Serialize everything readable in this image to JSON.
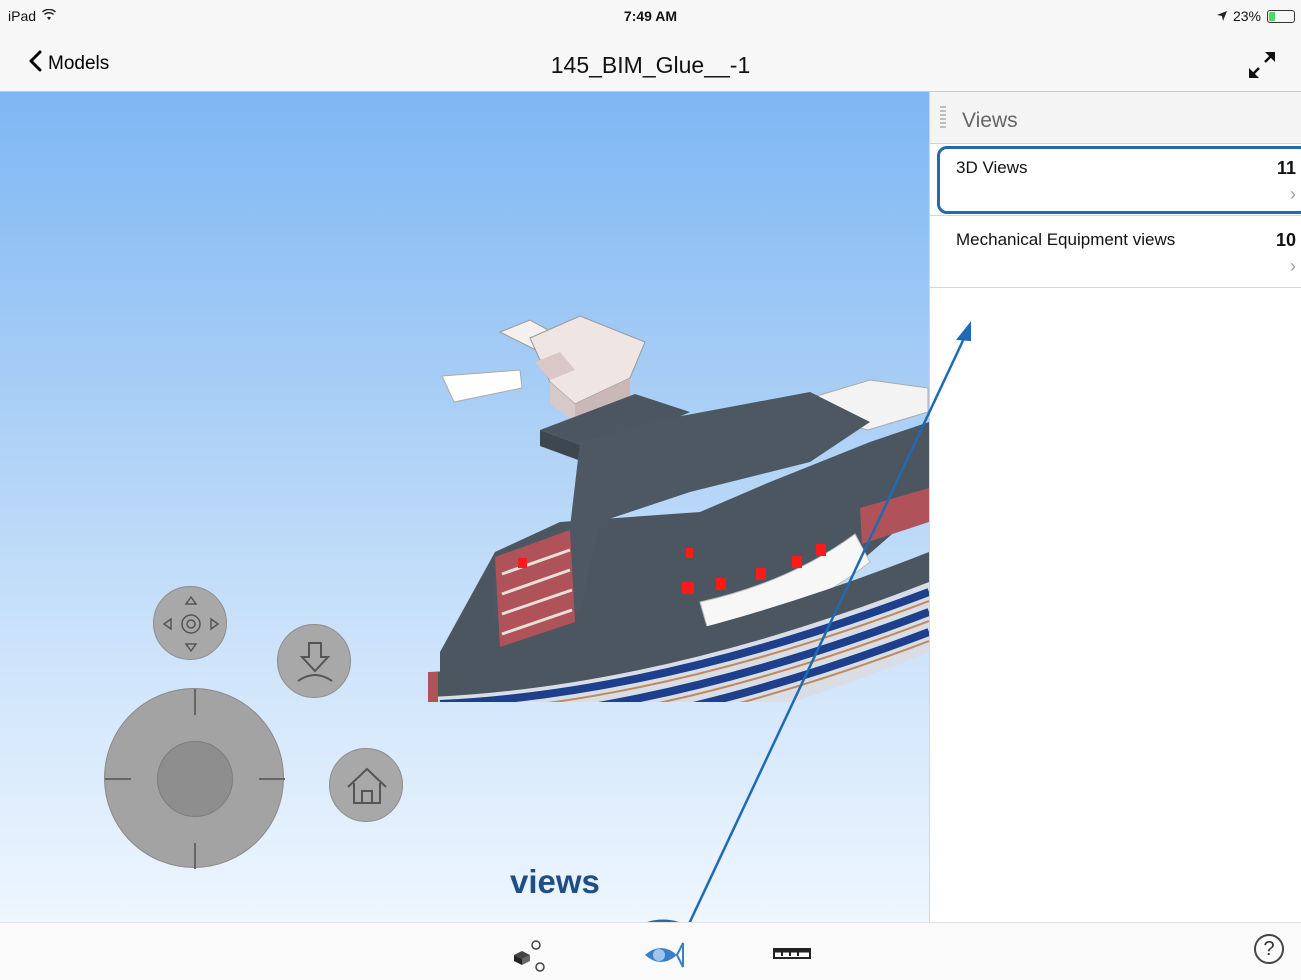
{
  "status_bar": {
    "device": "iPad",
    "time": "7:49 AM",
    "battery": "23%",
    "battery_level": 0.23,
    "icons": [
      "wifi-icon",
      "location-arrow-icon",
      "battery-icon"
    ]
  },
  "nav": {
    "back_label": "Models",
    "title": "145_BIM_Glue__-1",
    "expand_icon": "expand-icon"
  },
  "views_panel": {
    "title": "Views",
    "items": [
      {
        "name": "3D Views",
        "count": "11"
      },
      {
        "name": "Mechanical Equipment views",
        "count": "10"
      }
    ]
  },
  "annotation": {
    "label": "views",
    "color": "#1f6ab3"
  },
  "toolbar": {
    "items": [
      "model-tree-icon",
      "views-eye-icon",
      "measure-ruler-icon"
    ],
    "help_label": "?"
  },
  "colors": {
    "sky_top": "#7eb7f4",
    "roof": "#4b5660",
    "brick": "#b0525a",
    "window_band": "#1e3f8c",
    "equipment": "#ff1a1a"
  }
}
